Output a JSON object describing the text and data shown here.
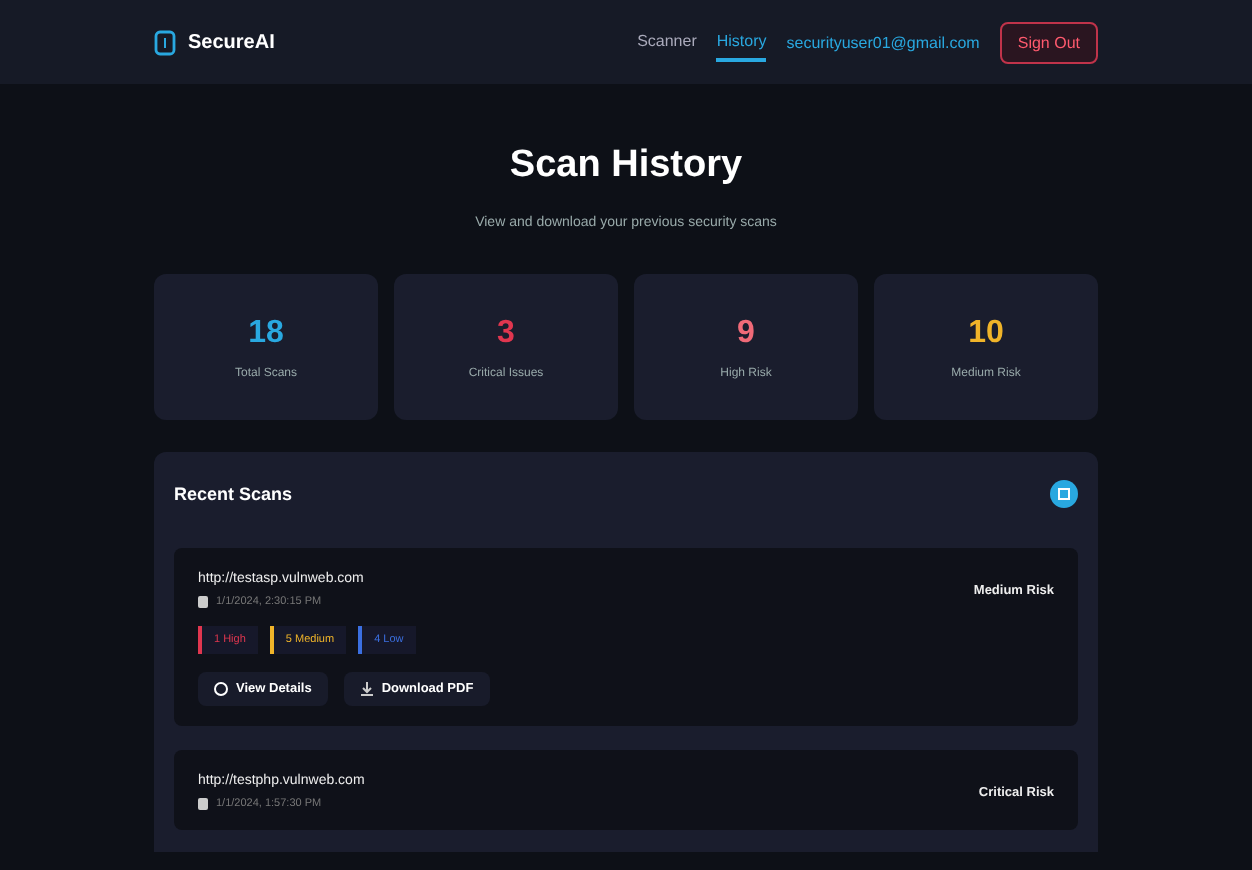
{
  "header": {
    "brand": "SecureAI",
    "nav": [
      {
        "label": "Scanner",
        "selected": false
      },
      {
        "label": "History",
        "selected": true
      }
    ],
    "user_email": "securityuser01@gmail.com",
    "sign_out": "Sign Out"
  },
  "page": {
    "title": "Scan History",
    "subtitle": "View and download your previous security scans"
  },
  "stats": [
    {
      "value": "18",
      "label": "Total Scans",
      "color": "#29a8e0"
    },
    {
      "value": "3",
      "label": "Critical Issues",
      "color": "#e0364f"
    },
    {
      "value": "9",
      "label": "High Risk",
      "color": "#f06a78"
    },
    {
      "value": "10",
      "label": "Medium Risk",
      "color": "#f0b429"
    }
  ],
  "recent": {
    "title": "Recent Scans",
    "scans": [
      {
        "url": "http://testasp.vulnweb.com",
        "date": "1/1/2024, 2:30:15 PM",
        "risk": "Medium Risk",
        "badges": [
          {
            "text": "1 High",
            "color": "#e0364f"
          },
          {
            "text": "5 Medium",
            "color": "#f0b429"
          },
          {
            "text": "4 Low",
            "color": "#3b6fe0"
          }
        ],
        "actions": [
          {
            "kind": "view",
            "label": "View Details"
          },
          {
            "kind": "download",
            "label": "Download PDF"
          }
        ]
      },
      {
        "url": "http://testphp.vulnweb.com",
        "date": "1/1/2024, 1:57:30 PM",
        "risk": "Critical Risk"
      }
    ]
  }
}
